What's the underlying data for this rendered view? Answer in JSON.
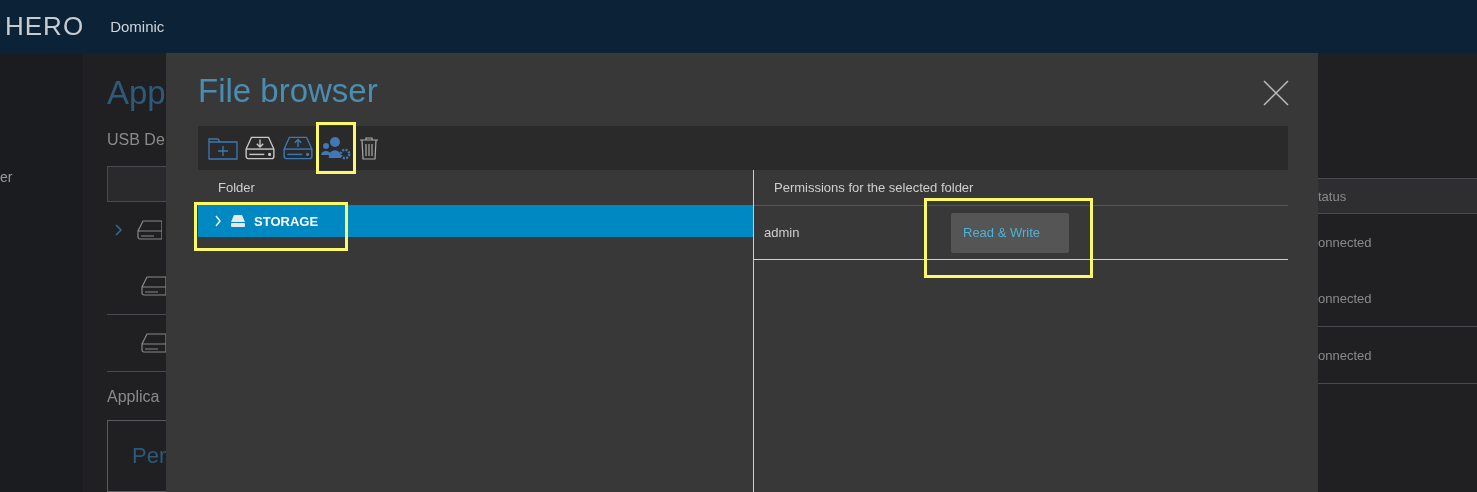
{
  "header": {
    "logo": "HERO",
    "user": "Dominic"
  },
  "background_left": {
    "sidebar_item": "er",
    "title": "App",
    "section": "USB De",
    "rows": [
      {
        "expander": true
      },
      {
        "expander": false
      },
      {
        "expander": false
      }
    ],
    "section_2": "Applica",
    "card_title": "Per"
  },
  "background_right": {
    "column_header": "tatus",
    "rows": [
      "onnected",
      "onnected",
      "onnected"
    ]
  },
  "dialog": {
    "title": "File browser",
    "toolbar": [
      {
        "kind": "new-folder",
        "highlighted": false
      },
      {
        "kind": "download",
        "highlighted": false
      },
      {
        "kind": "upload",
        "highlighted": false
      },
      {
        "kind": "permissions",
        "highlighted": true
      },
      {
        "kind": "delete",
        "highlighted": false
      }
    ],
    "folder_header": "Folder",
    "tree": [
      {
        "label": "STORAGE",
        "selected": true,
        "expanded": false,
        "highlighted": true
      }
    ],
    "permissions_header": "Permissions for the selected folder",
    "permissions": [
      {
        "user": "admin",
        "access": "Read & Write",
        "highlighted": true
      }
    ]
  }
}
